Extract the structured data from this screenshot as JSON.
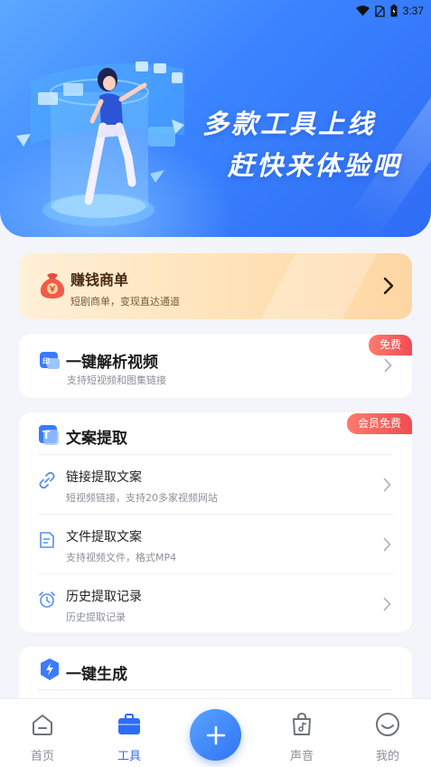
{
  "status": {
    "time": "3:37"
  },
  "banner": {
    "line1": "多款工具上线",
    "line2": "赶快来体验吧"
  },
  "earn": {
    "title": "赚钱商单",
    "subtitle": "短剧商单，变现直达通道"
  },
  "parse_video": {
    "title": "一键解析视频",
    "subtitle": "支持短视频和图集链接",
    "badge": "免费"
  },
  "text_extract": {
    "title": "文案提取",
    "badge": "会员免费",
    "items": [
      {
        "title": "链接提取文案",
        "subtitle": "短视频链接，支持20多家视频网站",
        "icon": "link-icon"
      },
      {
        "title": "文件提取文案",
        "subtitle": "支持视频文件，格式MP4",
        "icon": "document-icon"
      },
      {
        "title": "历史提取记录",
        "subtitle": "历史提取记录",
        "icon": "alarm-clock-icon"
      }
    ]
  },
  "generate": {
    "title": "一键生成"
  },
  "nav": {
    "items": [
      {
        "label": "首页",
        "icon": "home-icon"
      },
      {
        "label": "工具",
        "icon": "toolbox-icon"
      },
      {
        "label": "声音",
        "icon": "music-bag-icon"
      },
      {
        "label": "我的",
        "icon": "smiley-face-icon"
      }
    ],
    "fab_icon": "plus-icon",
    "active": "工具"
  },
  "colors": {
    "primary": "#2f6cf5",
    "badge": "#f04c52",
    "earn_bg": "#ffe2b8",
    "page_bg": "#f3f5fa"
  }
}
